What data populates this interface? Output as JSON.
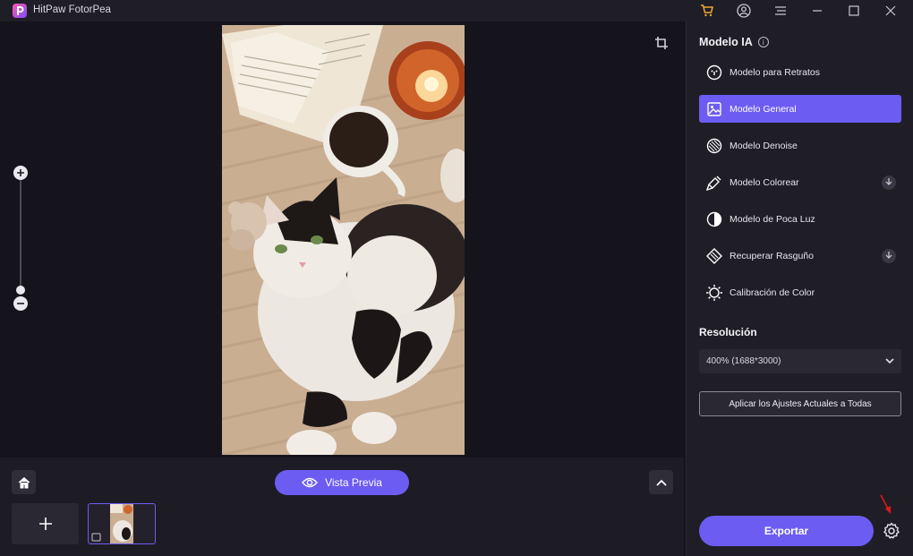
{
  "window": {
    "title": "HitPaw FotorPea"
  },
  "panel": {
    "title": "Modelo IA",
    "models": [
      {
        "label": "Modelo para Retratos",
        "icon": "portrait-icon",
        "active": false,
        "download": false
      },
      {
        "label": "Modelo General",
        "icon": "image-icon",
        "active": true,
        "download": false
      },
      {
        "label": "Modelo Denoise",
        "icon": "denoise-icon",
        "active": false,
        "download": false
      },
      {
        "label": "Modelo Colorear",
        "icon": "colorize-icon",
        "active": false,
        "download": true
      },
      {
        "label": "Modelo de Poca Luz",
        "icon": "low-light-icon",
        "active": false,
        "download": false
      },
      {
        "label": "Recuperar Rasguño",
        "icon": "scratch-icon",
        "active": false,
        "download": true
      },
      {
        "label": "Calibración de Color",
        "icon": "color-calibration-icon",
        "active": false,
        "download": false
      }
    ],
    "resolution_title": "Resolución",
    "resolution_value": "400% (1688*3000)",
    "apply_label": "Aplicar los Ajustes Actuales a Todas",
    "export_label": "Exportar"
  },
  "bottom": {
    "preview_label": "Vista Previa"
  },
  "colors": {
    "accent": "#6c5cf2",
    "background": "#15141c",
    "panel": "#1f1e27"
  }
}
